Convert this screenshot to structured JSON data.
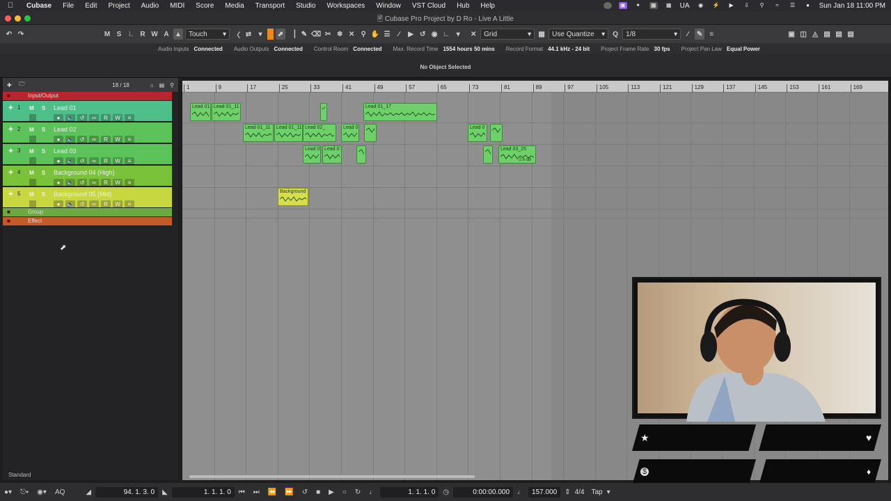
{
  "menubar": {
    "app": "Cubase",
    "items": [
      "File",
      "Edit",
      "Project",
      "Audio",
      "MIDI",
      "Score",
      "Media",
      "Transport",
      "Studio",
      "Workspaces",
      "Window",
      "VST Cloud",
      "Hub",
      "Help"
    ],
    "lang": "UA",
    "clock": "Sun Jan 18  11:00 PM"
  },
  "window": {
    "title": "Cubase Pro Project by D Ro - Live A Little"
  },
  "toolbar": {
    "mode_letters": [
      "M",
      "S",
      "L",
      "R",
      "W",
      "A"
    ],
    "automation_mode": "Touch",
    "snap_type": "Grid",
    "quantize_mode": "Use Quantize",
    "quantize_value": "1/8"
  },
  "status": [
    {
      "k": "Audio Inputs",
      "v": "Connected"
    },
    {
      "k": "Audio Outputs",
      "v": "Connected"
    },
    {
      "k": "Control Room",
      "v": "Connected"
    },
    {
      "k": "Max. Record Time",
      "v": "1554 hours 50 mins"
    },
    {
      "k": "Record Format",
      "v": "44.1 kHz - 24 bit"
    },
    {
      "k": "Project Frame Rate",
      "v": "30 fps"
    },
    {
      "k": "Project Pan Law",
      "v": "Equal Power"
    }
  ],
  "info": {
    "text": "No Object Selected"
  },
  "track_panel": {
    "count": "18 / 18",
    "standard": "Standard",
    "folder_top": "Input/Output",
    "folder_group": "Group",
    "folder_effect": "Effect"
  },
  "tracks": [
    {
      "num": "1",
      "name": "Lead 01",
      "color": "#4fbf8a"
    },
    {
      "num": "2",
      "name": "Lead 02",
      "color": "#5cc25a"
    },
    {
      "num": "3",
      "name": "Lead 03",
      "color": "#5cc25a"
    },
    {
      "num": "4",
      "name": "Background 04 (High)",
      "color": "#7ac23a"
    },
    {
      "num": "5",
      "name": "Background 05 (Mid)",
      "color": "#c8d640"
    }
  ],
  "track_buttons": {
    "mute": "M",
    "solo": "S",
    "read": "R",
    "write": "W"
  },
  "ruler": [
    "1",
    "9",
    "17",
    "25",
    "33",
    "41",
    "49",
    "57",
    "65",
    "73",
    "81",
    "89",
    "97",
    "105",
    "113",
    "121",
    "129",
    "137",
    "145",
    "153",
    "161",
    "169"
  ],
  "clips": [
    {
      "label": "Lead 01"
    },
    {
      "label": "Lead 01_11"
    },
    {
      "label": ""
    },
    {
      "label": "Lead 01_17"
    },
    {
      "label": "Lead 01_11"
    },
    {
      "label": "Lead 01_11"
    },
    {
      "label": "Lead 02_"
    },
    {
      "label": "Lead 0"
    },
    {
      "label": ""
    },
    {
      "label": "Lead 0"
    },
    {
      "label": ""
    },
    {
      "label": "Lead 0"
    },
    {
      "label": "Lead 0:"
    },
    {
      "label": ""
    },
    {
      "label": ""
    },
    {
      "label": "Lead 03_25"
    },
    {
      "label": "Background"
    }
  ],
  "clip_gain": "-2.6 dB",
  "transport": {
    "left_locator": "94.  1.  3.    0",
    "right_locator": "1.  1.  1.    0",
    "position": "1.  1.  1.    0",
    "time": "0:00:00.000",
    "tempo": "157.000",
    "signature": "4/4",
    "tap": "Tap"
  }
}
